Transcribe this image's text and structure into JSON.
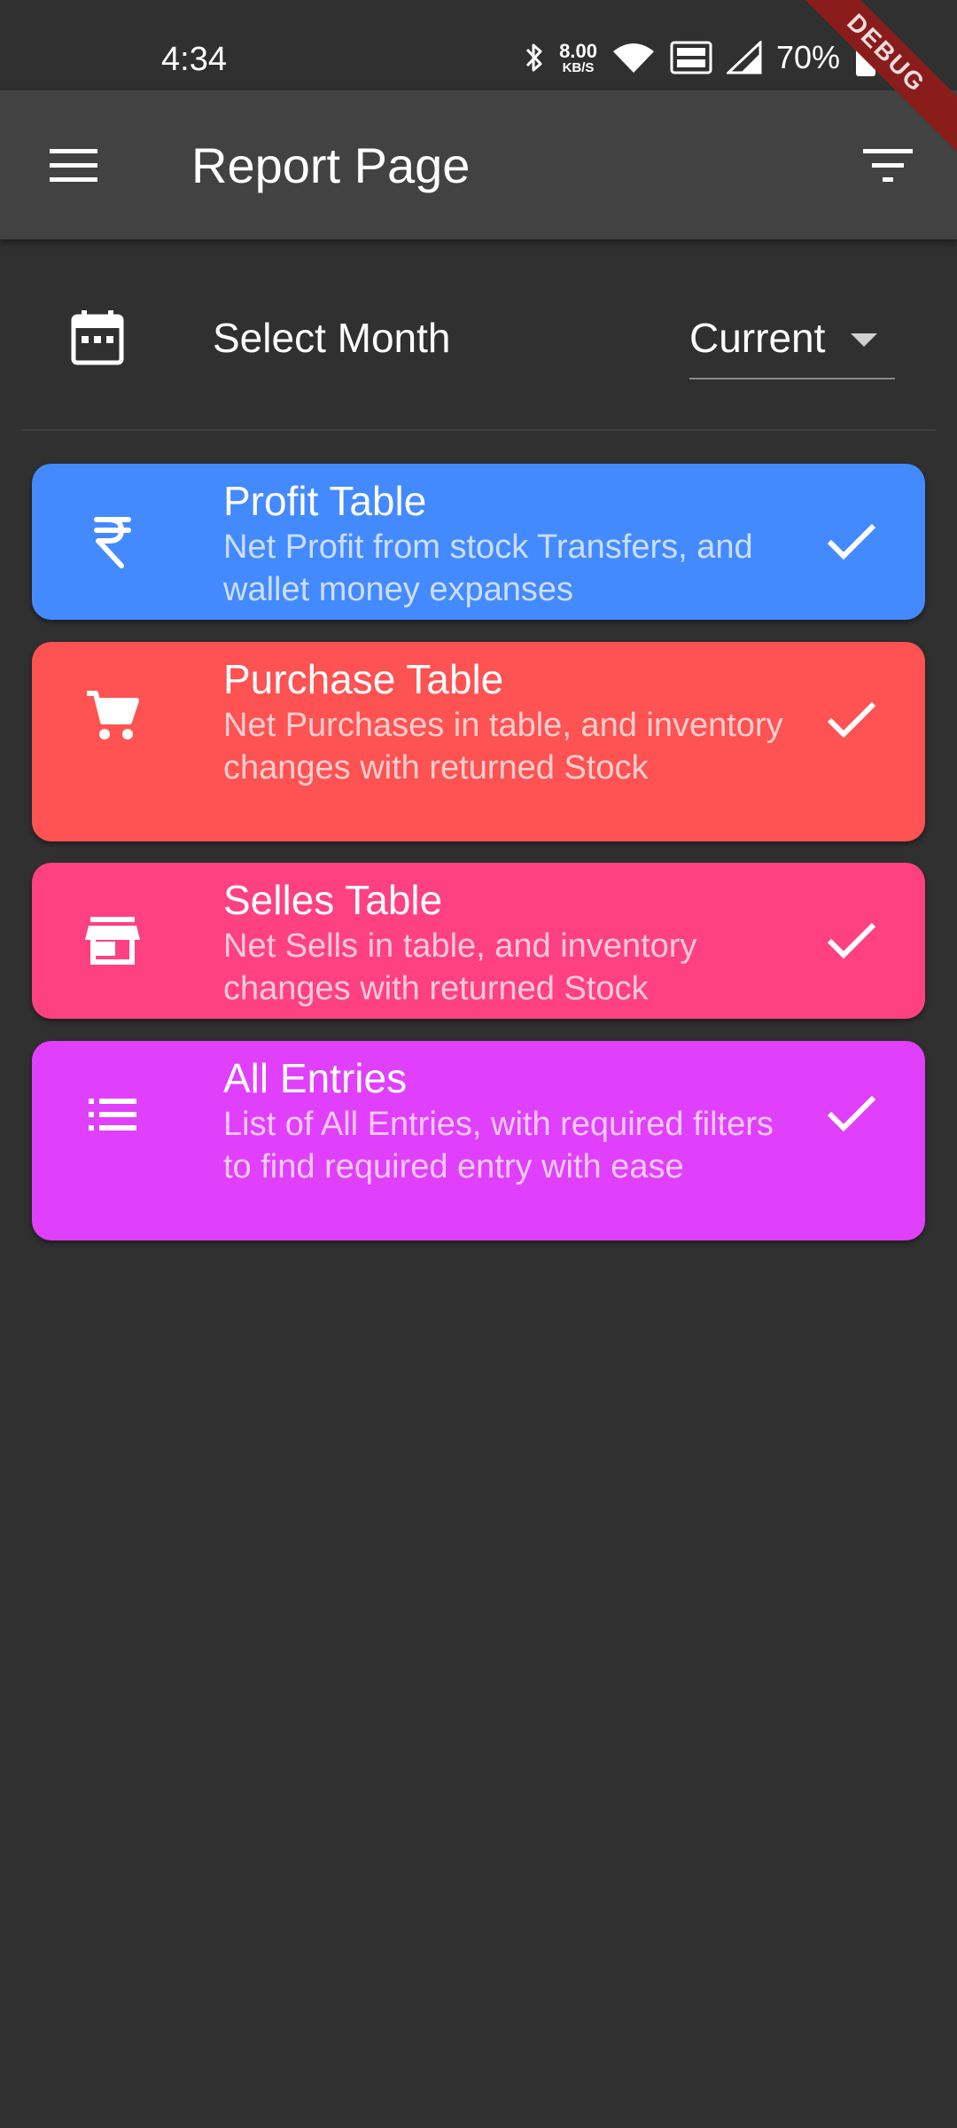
{
  "status_bar": {
    "time": "4:34",
    "speed_value": "8.00",
    "speed_unit": "KB/S",
    "battery": "70%",
    "debug_label": "DEBUG"
  },
  "app_bar": {
    "title": "Report Page",
    "menu_icon": "menu-icon",
    "filter_icon": "filter-icon"
  },
  "month_selector": {
    "label": "Select Month",
    "selected": "Current",
    "icon": "calendar-icon"
  },
  "reports": [
    {
      "title": "Profit Table",
      "description": "Net Profit from stock Transfers, and wallet money expanses",
      "icon": "rupee-icon",
      "color": "#448aff"
    },
    {
      "title": "Purchase Table",
      "description": "Net Purchases in table, and inventory changes with returned Stock",
      "icon": "cart-icon",
      "color": "#ff5252"
    },
    {
      "title": "Selles Table",
      "description": "Net Sells in table, and inventory changes with returned Stock",
      "icon": "store-icon",
      "color": "#ff4081"
    },
    {
      "title": "All Entries",
      "description": "List of All Entries, with required filters to find required entry with ease",
      "icon": "list-icon",
      "color": "#e040fb"
    }
  ]
}
